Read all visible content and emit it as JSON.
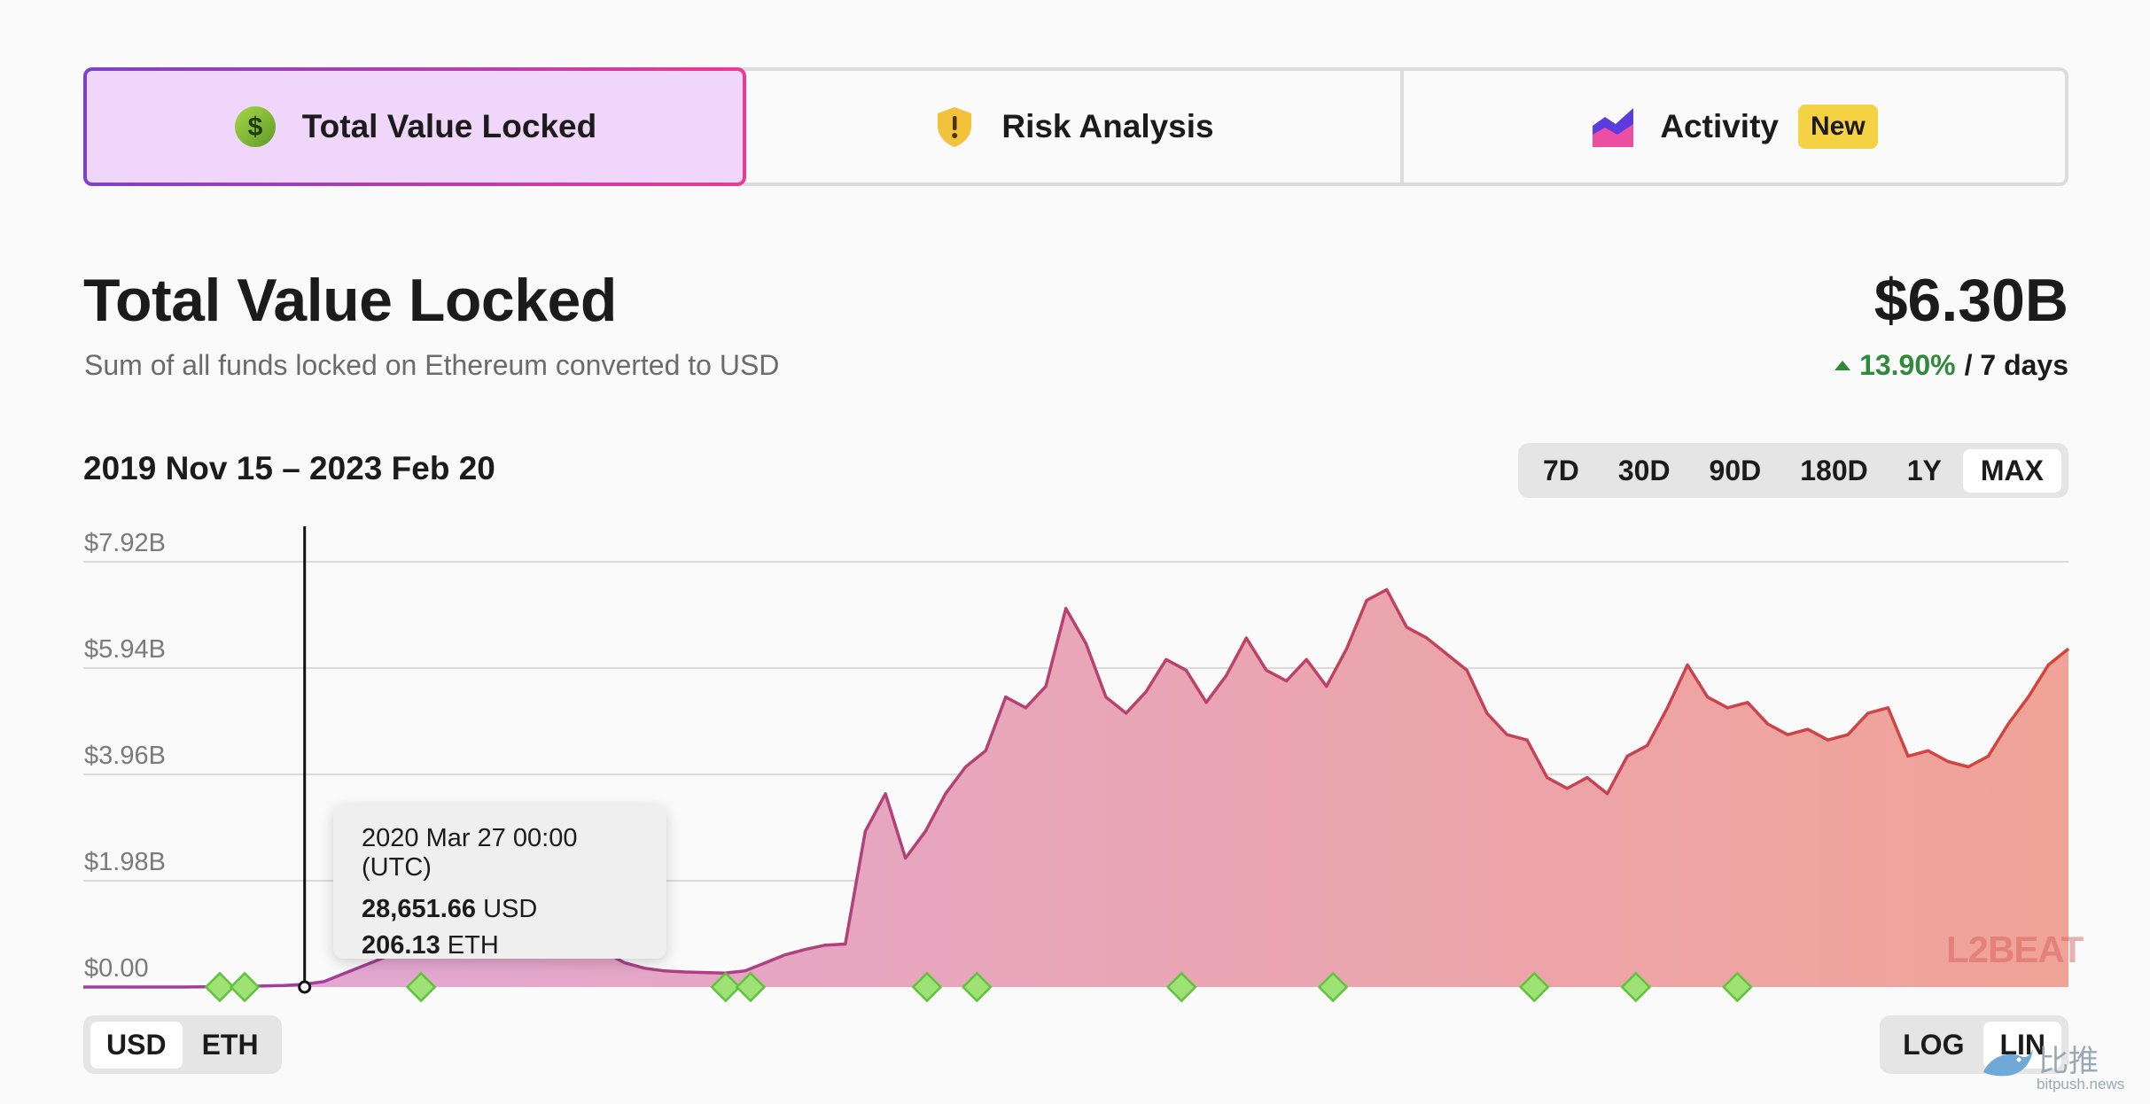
{
  "tabs": [
    {
      "label": "Total Value Locked",
      "icon": "dollar-coin-icon",
      "active": true
    },
    {
      "label": "Risk Analysis",
      "icon": "warning-shield-icon",
      "active": false
    },
    {
      "label": "Activity",
      "icon": "area-chart-icon",
      "active": false,
      "badge": "New"
    }
  ],
  "header": {
    "title": "Total Value Locked",
    "subtitle": "Sum of all funds locked on Ethereum converted to USD",
    "value": "$6.30B",
    "change_pct": "13.90%",
    "change_period": "/ 7 days"
  },
  "range_label": "2019 Nov 15 – 2023 Feb 20",
  "time_buttons": [
    "7D",
    "30D",
    "90D",
    "180D",
    "1Y",
    "MAX"
  ],
  "time_selected": "MAX",
  "unit_buttons": [
    "USD",
    "ETH"
  ],
  "unit_selected": "USD",
  "scale_buttons": [
    "LOG",
    "LIN"
  ],
  "scale_selected": "LIN",
  "tooltip": {
    "date": "2020 Mar 27 00:00 (UTC)",
    "usd_value": "28,651.66",
    "usd_unit": "USD",
    "eth_value": "206.13",
    "eth_unit": "ETH"
  },
  "logo": "L2BEAT",
  "watermark": {
    "text": "比推",
    "sub": "bitpush.news"
  },
  "colors": {
    "line_start": "#9a3fa3",
    "line_end": "#d5443a",
    "fill_start": "#e0a8da",
    "fill_end": "#f0a396",
    "event_marker": "#9ee276"
  },
  "chart_data": {
    "type": "area",
    "y_ticks": [
      "$0.00",
      "$1.98B",
      "$3.96B",
      "$5.94B",
      "$7.92B"
    ],
    "y_tick_values": [
      0,
      1.98,
      3.96,
      5.94,
      7.92
    ],
    "y_unit": "B USD",
    "ylim": [
      0,
      7.92
    ],
    "x_start": "2019-11-15",
    "x_end": "2023-02-20",
    "grid": true,
    "series": [
      {
        "values_usd_billions": [
          0,
          0,
          0,
          0,
          0,
          0,
          0.005,
          0.01,
          0.01,
          0.02,
          0.03,
          0.05,
          0.1,
          0.25,
          0.4,
          0.55,
          0.6,
          1.0,
          1.65,
          0.8,
          0.6,
          0.9,
          1.45,
          1.4,
          1.25,
          0.95,
          0.65,
          0.45,
          0.35,
          0.3,
          0.28,
          0.27,
          0.26,
          0.3,
          0.45,
          0.6,
          0.7,
          0.78,
          0.8,
          2.9,
          3.6,
          2.4,
          2.9,
          3.6,
          4.1,
          4.4,
          5.4,
          5.2,
          5.6,
          7.05,
          6.4,
          5.4,
          5.1,
          5.5,
          6.1,
          5.9,
          5.3,
          5.8,
          6.5,
          5.9,
          5.7,
          6.1,
          5.6,
          6.3,
          7.2,
          7.4,
          6.7,
          6.5,
          6.2,
          5.9,
          5.1,
          4.7,
          4.6,
          3.9,
          3.7,
          3.9,
          3.6,
          4.3,
          4.5,
          5.2,
          6.0,
          5.4,
          5.2,
          5.3,
          4.9,
          4.7,
          4.8,
          4.6,
          4.7,
          5.1,
          5.2,
          4.3,
          4.4,
          4.2,
          4.1,
          4.3,
          4.9,
          5.4,
          6.0,
          6.3
        ]
      }
    ],
    "hover_point": {
      "date": "2020-03-27",
      "value_usd": 28651.66,
      "value_eth": 206.13
    },
    "event_markers": [
      "2020-02",
      "2020-02",
      "2020-06",
      "2020-12",
      "2020-12",
      "2021-04",
      "2021-05",
      "2021-09",
      "2021-12",
      "2022-04",
      "2022-06",
      "2022-08"
    ]
  }
}
